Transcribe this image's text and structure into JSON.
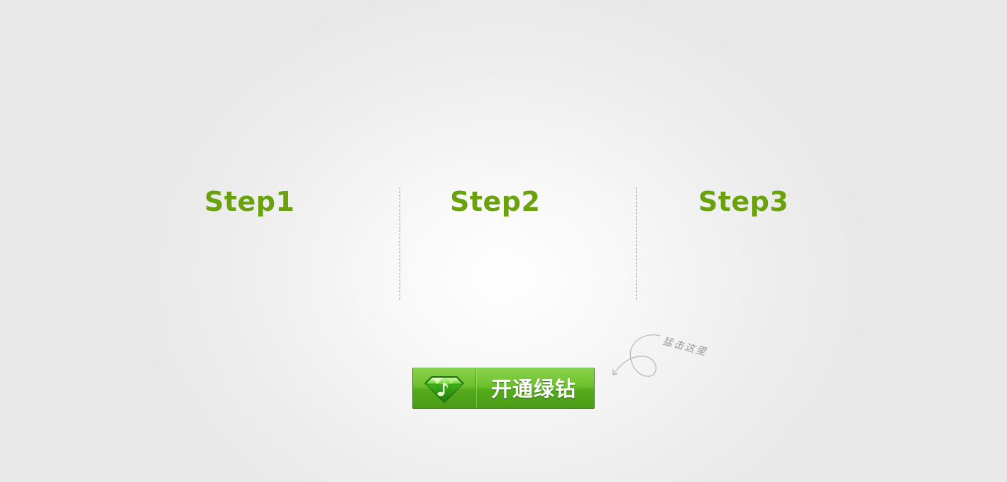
{
  "steps": [
    {
      "title": "Step1"
    },
    {
      "title": "Step2"
    },
    {
      "title": "Step3"
    }
  ],
  "cta": {
    "label": "开通绿钻",
    "icon": "green-diamond-music-note-icon"
  },
  "hint": {
    "text": "猛击这里",
    "icon": "curved-arrow-icon"
  },
  "colors": {
    "step_title": "#6aa20e",
    "button_green": "#6cc02c",
    "button_border": "#3f8f16",
    "hint_gray": "#9a9a9a"
  }
}
